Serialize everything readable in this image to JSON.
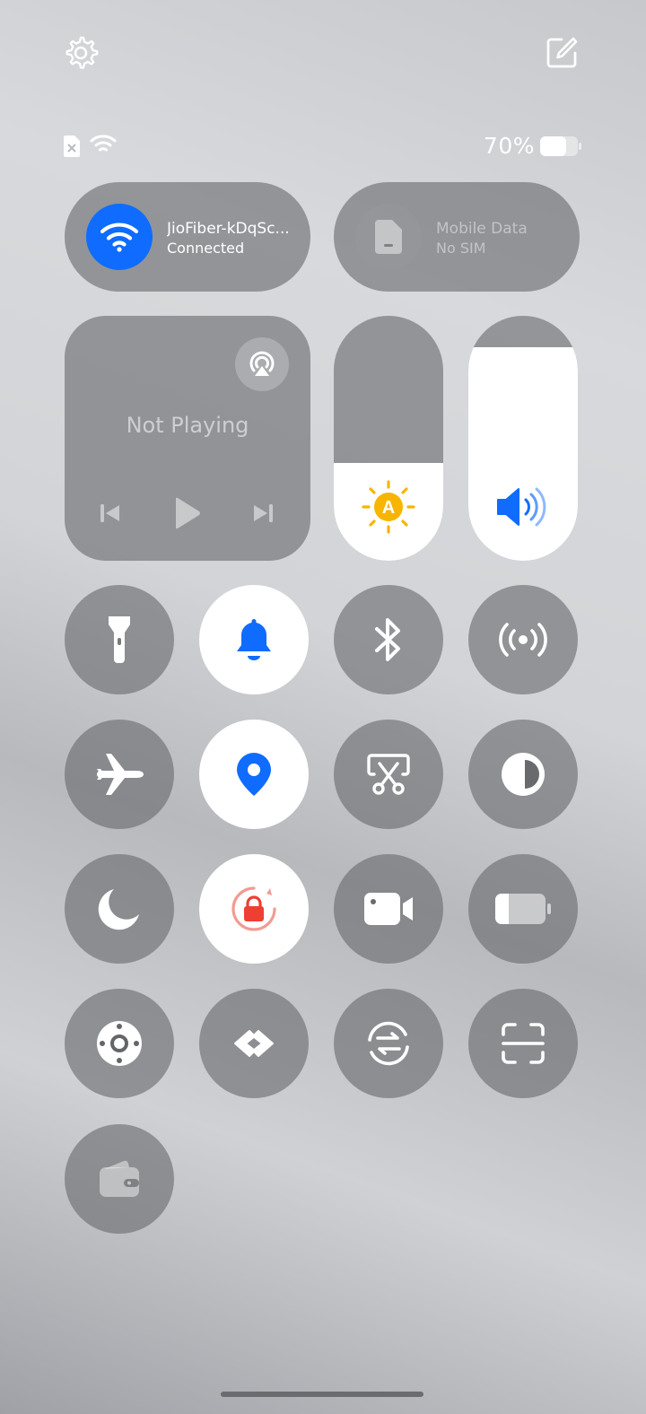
{
  "status": {
    "battery_percent_text": "70%",
    "battery_level": 0.7
  },
  "wifi": {
    "network_name": "JioFiber-kDqSc...",
    "status": "Connected",
    "accent_color": "#0f6cff"
  },
  "mobile_data": {
    "title": "Mobile Data",
    "status": "No SIM"
  },
  "media": {
    "status_text": "Not Playing"
  },
  "brightness": {
    "level": 0.4,
    "auto_badge": "A",
    "icon_color": "#f7b500"
  },
  "volume": {
    "level": 0.87,
    "icon_color": "#0f6cff"
  },
  "toggles": [
    {
      "icon": "flashlight-icon",
      "on": false
    },
    {
      "icon": "bell-icon",
      "on": true
    },
    {
      "icon": "bluetooth-icon",
      "on": false
    },
    {
      "icon": "hotspot-icon",
      "on": false
    },
    {
      "icon": "airplane-icon",
      "on": false
    },
    {
      "icon": "location-icon",
      "on": true
    },
    {
      "icon": "screenshot-icon",
      "on": false
    },
    {
      "icon": "contrast-icon",
      "on": false
    },
    {
      "icon": "moon-icon",
      "on": false
    },
    {
      "icon": "rotation-lock-icon",
      "on": true
    },
    {
      "icon": "screen-record-icon",
      "on": false
    },
    {
      "icon": "battery-saver-icon",
      "on": false
    },
    {
      "icon": "assistive-touch-icon",
      "on": false
    },
    {
      "icon": "link-icon",
      "on": false
    },
    {
      "icon": "sync-icon",
      "on": false
    },
    {
      "icon": "scan-icon",
      "on": false
    },
    {
      "icon": "wallet-icon",
      "on": false
    }
  ]
}
